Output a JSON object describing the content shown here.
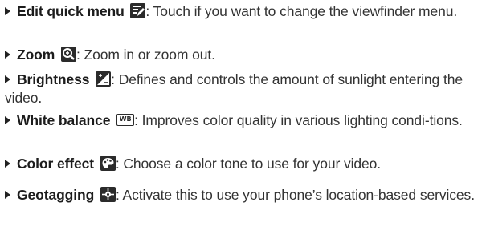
{
  "items": [
    {
      "term": "Edit quick menu",
      "icon": "edit-quick-menu-icon",
      "description": ": Touch if you want to change the viewfinder menu."
    },
    {
      "term": "Zoom",
      "icon": "zoom-in-icon",
      "description": ": Zoom in or zoom out."
    },
    {
      "term": "Brightness",
      "icon": "brightness-icon",
      "description": ": Defines and controls the amount of sunlight entering the video."
    },
    {
      "term": "White balance",
      "icon": "white-balance-icon",
      "icon_text": "WB",
      "description": ": Improves color quality in various lighting condi-tions."
    },
    {
      "term": "Color effect",
      "icon": "color-effect-icon",
      "description": ": Choose a color tone to use for your video."
    },
    {
      "term": "Geotagging",
      "icon": "geotagging-icon",
      "description": ": Activate this to use your phone’s location-based services."
    }
  ],
  "colors": {
    "text": "#222222",
    "icon": "#2b2b2b"
  }
}
